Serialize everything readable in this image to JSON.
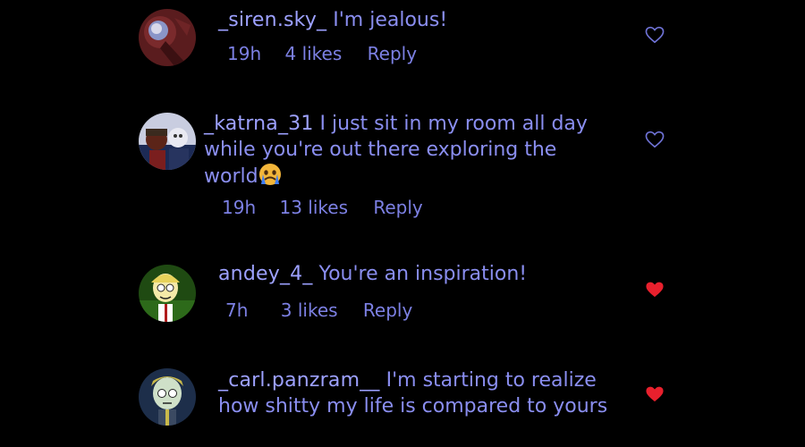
{
  "comments": [
    {
      "username": "_siren.sky_",
      "text": "I'm jealous!",
      "time": "19h",
      "likes": "4 likes",
      "reply": "Reply",
      "liked": false,
      "avatar": "avatar-siren",
      "heart_icon": "heart-outline-icon"
    },
    {
      "username": "_katrna_31",
      "text": "I just sit in my room all day while you're out there exploring the world",
      "emoji": "crying-face-emoji",
      "time": "19h",
      "likes": "13 likes",
      "reply": "Reply",
      "liked": false,
      "avatar": "avatar-katrna",
      "heart_icon": "heart-outline-icon"
    },
    {
      "username": "andey_4_",
      "text": "You're an inspiration!",
      "time": "7h",
      "likes": "3 likes",
      "reply": "Reply",
      "liked": true,
      "avatar": "avatar-andey",
      "heart_icon": "heart-filled-icon"
    },
    {
      "username": "_carl.panzram__",
      "text": "I'm starting to realize how shitty my life is compared to yours",
      "liked": true,
      "avatar": "avatar-carl",
      "heart_icon": "heart-filled-icon"
    }
  ],
  "colors": {
    "background": "#000000",
    "text": "#8a8ef0",
    "username": "#9da1ff",
    "heart_outline": "#6f73d6",
    "heart_filled": "#e8202d"
  }
}
